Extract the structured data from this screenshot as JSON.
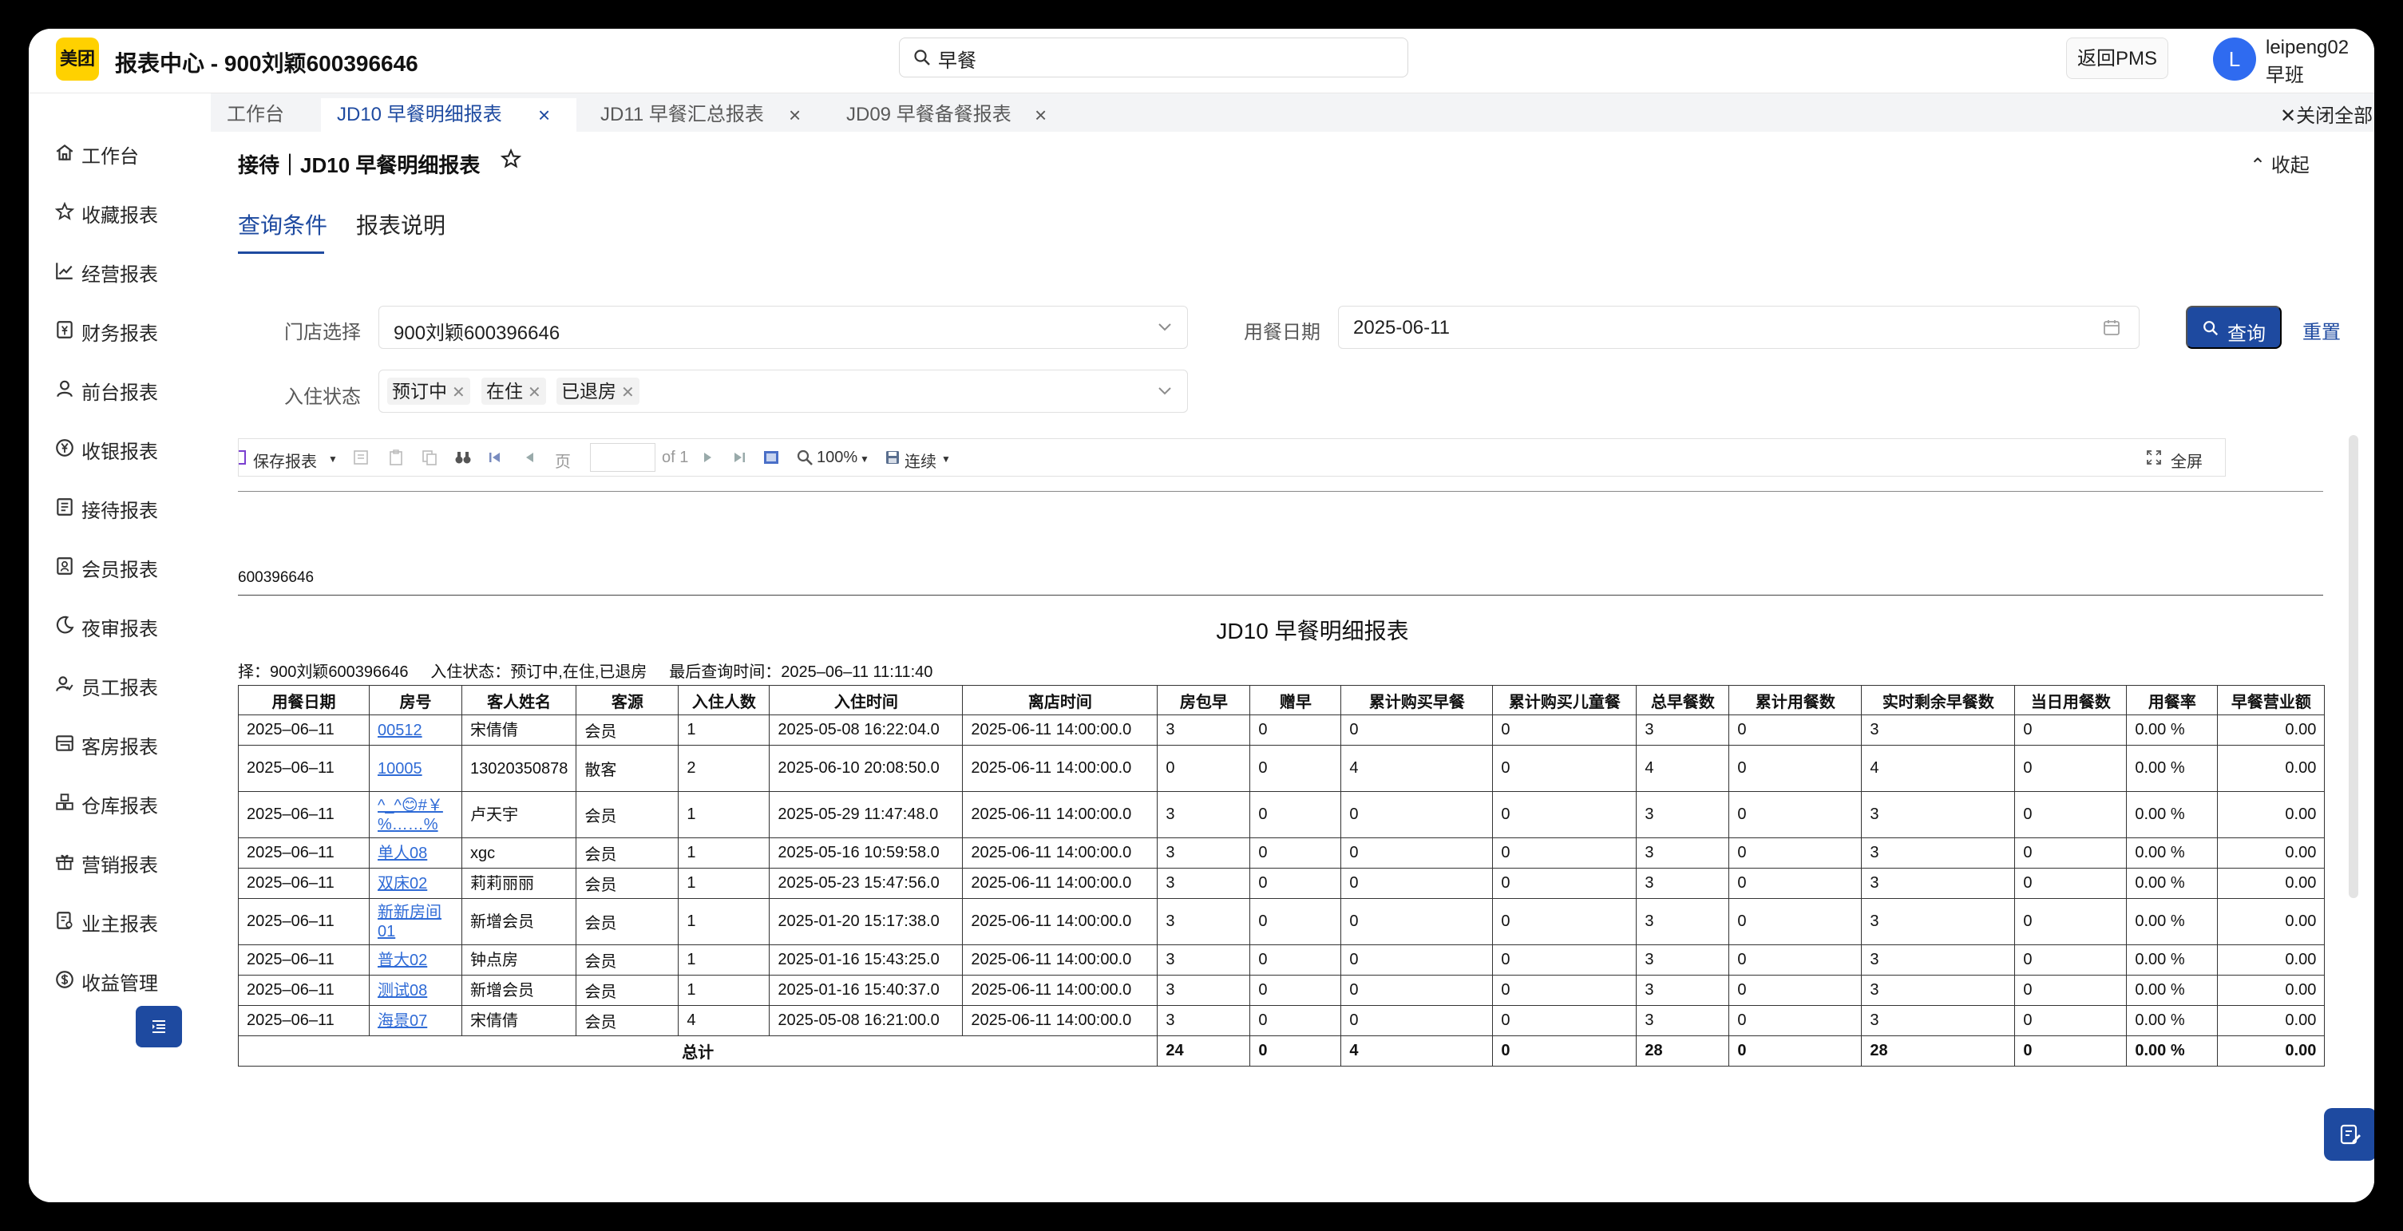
{
  "header": {
    "logo_text": "美团",
    "title": "报表中心 - 900刘颖600396646",
    "search_value": "早餐",
    "return_pms": "返回PMS",
    "avatar_letter": "L",
    "user_name": "leipeng02",
    "user_shift": "早班"
  },
  "sidebar": {
    "items": [
      {
        "label": "工作台",
        "icon": "home-icon"
      },
      {
        "label": "收藏报表",
        "icon": "star-icon"
      },
      {
        "label": "经营报表",
        "icon": "line-chart-icon"
      },
      {
        "label": "财务报表",
        "icon": "finance-icon"
      },
      {
        "label": "前台报表",
        "icon": "user-icon"
      },
      {
        "label": "收银报表",
        "icon": "yen-icon"
      },
      {
        "label": "接待报表",
        "icon": "reception-icon"
      },
      {
        "label": "会员报表",
        "icon": "member-icon"
      },
      {
        "label": "夜审报表",
        "icon": "moon-icon"
      },
      {
        "label": "员工报表",
        "icon": "staff-icon"
      },
      {
        "label": "客房报表",
        "icon": "room-icon"
      },
      {
        "label": "仓库报表",
        "icon": "warehouse-icon"
      },
      {
        "label": "营销报表",
        "icon": "gift-icon"
      },
      {
        "label": "业主报表",
        "icon": "owner-icon"
      },
      {
        "label": "收益管理",
        "icon": "dollar-icon"
      }
    ]
  },
  "tabs": {
    "workbench": "工作台",
    "items": [
      {
        "label": "JD10 早餐明细报表",
        "active": true
      },
      {
        "label": "JD11 早餐汇总报表",
        "active": false
      },
      {
        "label": "JD09 早餐备餐报表",
        "active": false
      }
    ],
    "close_all": "关闭全部"
  },
  "page": {
    "title": "接待｜JD10 早餐明细报表",
    "collapse": "收起",
    "query_tab": "查询条件",
    "desc_tab": "报表说明"
  },
  "filters": {
    "store_label": "门店选择",
    "store_value": "900刘颖600396646",
    "date_label": "用餐日期",
    "date_value": "2025-06-11",
    "status_label": "入住状态",
    "status_chips": [
      "预订中",
      "在住",
      "已退房"
    ],
    "query_btn": "查询",
    "reset_btn": "重置"
  },
  "viewer": {
    "save": "保存报表",
    "page_label": "页",
    "of_pages": "of 1",
    "zoom": "100%",
    "mode": "连续",
    "fullscreen": "全屏"
  },
  "report": {
    "hotel_id": "600396646",
    "title": "JD10 早餐明细报表",
    "info_store": "择：900刘颖600396646",
    "info_status": "入住状态：预订中,在住,已退房",
    "info_time": "最后查询时间：2025–06–11 11:11:40",
    "columns": [
      "用餐日期",
      "房号",
      "客人姓名",
      "客源",
      "入住人数",
      "入住时间",
      "离店时间",
      "房包早",
      "赠早",
      "累计购买早餐",
      "累计购买儿童餐",
      "总早餐数",
      "累计用餐数",
      "实时剩余早餐数",
      "当日用餐数",
      "用餐率",
      "早餐营业额"
    ],
    "rows": [
      {
        "date": "2025–06–11",
        "room": "00512",
        "guest": "宋倩倩",
        "source": "会员",
        "persons": "1",
        "checkin": "2025-05-08 16:22:04.0",
        "checkout": "2025-06-11 14:00:00.0",
        "pkg": "3",
        "free": "0",
        "buy": "0",
        "child": "0",
        "total": "3",
        "used": "0",
        "remain": "3",
        "today": "0",
        "rate": "0.00 %",
        "revenue": "0.00"
      },
      {
        "date": "2025–06–11",
        "room": "10005",
        "guest": "13020350878",
        "source": "散客",
        "persons": "2",
        "checkin": "2025-06-10 20:08:50.0",
        "checkout": "2025-06-11 14:00:00.0",
        "pkg": "0",
        "free": "0",
        "buy": "4",
        "child": "0",
        "total": "4",
        "used": "0",
        "remain": "4",
        "today": "0",
        "rate": "0.00 %",
        "revenue": "0.00"
      },
      {
        "date": "2025–06–11",
        "room": "^_^😊#￥%……%",
        "guest": "卢天宇",
        "source": "会员",
        "persons": "1",
        "checkin": "2025-05-29 11:47:48.0",
        "checkout": "2025-06-11 14:00:00.0",
        "pkg": "3",
        "free": "0",
        "buy": "0",
        "child": "0",
        "total": "3",
        "used": "0",
        "remain": "3",
        "today": "0",
        "rate": "0.00 %",
        "revenue": "0.00"
      },
      {
        "date": "2025–06–11",
        "room": "单人08",
        "guest": "xgc",
        "source": "会员",
        "persons": "1",
        "checkin": "2025-05-16 10:59:58.0",
        "checkout": "2025-06-11 14:00:00.0",
        "pkg": "3",
        "free": "0",
        "buy": "0",
        "child": "0",
        "total": "3",
        "used": "0",
        "remain": "3",
        "today": "0",
        "rate": "0.00 %",
        "revenue": "0.00"
      },
      {
        "date": "2025–06–11",
        "room": "双床02",
        "guest": "莉莉丽丽",
        "source": "会员",
        "persons": "1",
        "checkin": "2025-05-23 15:47:56.0",
        "checkout": "2025-06-11 14:00:00.0",
        "pkg": "3",
        "free": "0",
        "buy": "0",
        "child": "0",
        "total": "3",
        "used": "0",
        "remain": "3",
        "today": "0",
        "rate": "0.00 %",
        "revenue": "0.00"
      },
      {
        "date": "2025–06–11",
        "room": "新新房间01",
        "guest": "新增会员",
        "source": "会员",
        "persons": "1",
        "checkin": "2025-01-20 15:17:38.0",
        "checkout": "2025-06-11 14:00:00.0",
        "pkg": "3",
        "free": "0",
        "buy": "0",
        "child": "0",
        "total": "3",
        "used": "0",
        "remain": "3",
        "today": "0",
        "rate": "0.00 %",
        "revenue": "0.00"
      },
      {
        "date": "2025–06–11",
        "room": "普大02",
        "guest": "钟点房",
        "source": "会员",
        "persons": "1",
        "checkin": "2025-01-16 15:43:25.0",
        "checkout": "2025-06-11 14:00:00.0",
        "pkg": "3",
        "free": "0",
        "buy": "0",
        "child": "0",
        "total": "3",
        "used": "0",
        "remain": "3",
        "today": "0",
        "rate": "0.00 %",
        "revenue": "0.00"
      },
      {
        "date": "2025–06–11",
        "room": "测试08",
        "guest": "新增会员",
        "source": "会员",
        "persons": "1",
        "checkin": "2025-01-16 15:40:37.0",
        "checkout": "2025-06-11 14:00:00.0",
        "pkg": "3",
        "free": "0",
        "buy": "0",
        "child": "0",
        "total": "3",
        "used": "0",
        "remain": "3",
        "today": "0",
        "rate": "0.00 %",
        "revenue": "0.00"
      },
      {
        "date": "2025–06–11",
        "room": "海景07",
        "guest": "宋倩倩",
        "source": "会员",
        "persons": "4",
        "checkin": "2025-05-08 16:21:00.0",
        "checkout": "2025-06-11 14:00:00.0",
        "pkg": "3",
        "free": "0",
        "buy": "0",
        "child": "0",
        "total": "3",
        "used": "0",
        "remain": "3",
        "today": "0",
        "rate": "0.00 %",
        "revenue": "0.00"
      }
    ],
    "total": {
      "label": "总计",
      "pkg": "24",
      "free": "0",
      "buy": "4",
      "child": "0",
      "total": "28",
      "used": "0",
      "remain": "28",
      "today": "0",
      "rate": "0.00 %",
      "revenue": "0.00"
    }
  }
}
